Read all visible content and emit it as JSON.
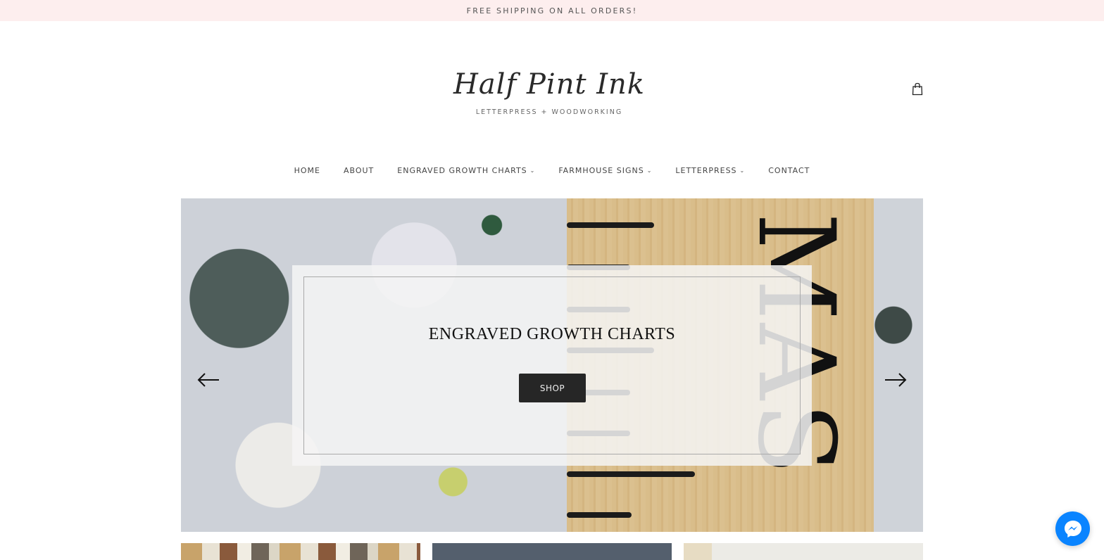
{
  "announcement": {
    "text": "FREE SHIPPING ON ALL ORDERS!"
  },
  "header": {
    "logo_script": "Half Pint Ink",
    "logo_tagline": "LETTERPRESS + WOODWORKING",
    "cart_icon": "shopping-bag-icon"
  },
  "nav": {
    "items": [
      {
        "label": "HOME",
        "has_dropdown": false
      },
      {
        "label": "ABOUT",
        "has_dropdown": false
      },
      {
        "label": "ENGRAVED GROWTH CHARTS",
        "has_dropdown": true
      },
      {
        "label": "FARMHOUSE SIGNS",
        "has_dropdown": true
      },
      {
        "label": "LETTERPRESS",
        "has_dropdown": true
      },
      {
        "label": "CONTACT",
        "has_dropdown": false
      }
    ],
    "dropdown_glyph": "⌄"
  },
  "hero": {
    "title": "ENGRAVED GROWTH CHARTS",
    "button_label": "SHOP",
    "image_text": "MAS",
    "prev_icon": "arrow-left-icon",
    "next_icon": "arrow-right-icon"
  },
  "colors": {
    "announcement_bg": "#fdeeee",
    "button_bg": "#262626",
    "messenger_blue": "#0a84ff",
    "thumb_slate": "#545f6d"
  },
  "chat": {
    "icon": "messenger-icon"
  }
}
